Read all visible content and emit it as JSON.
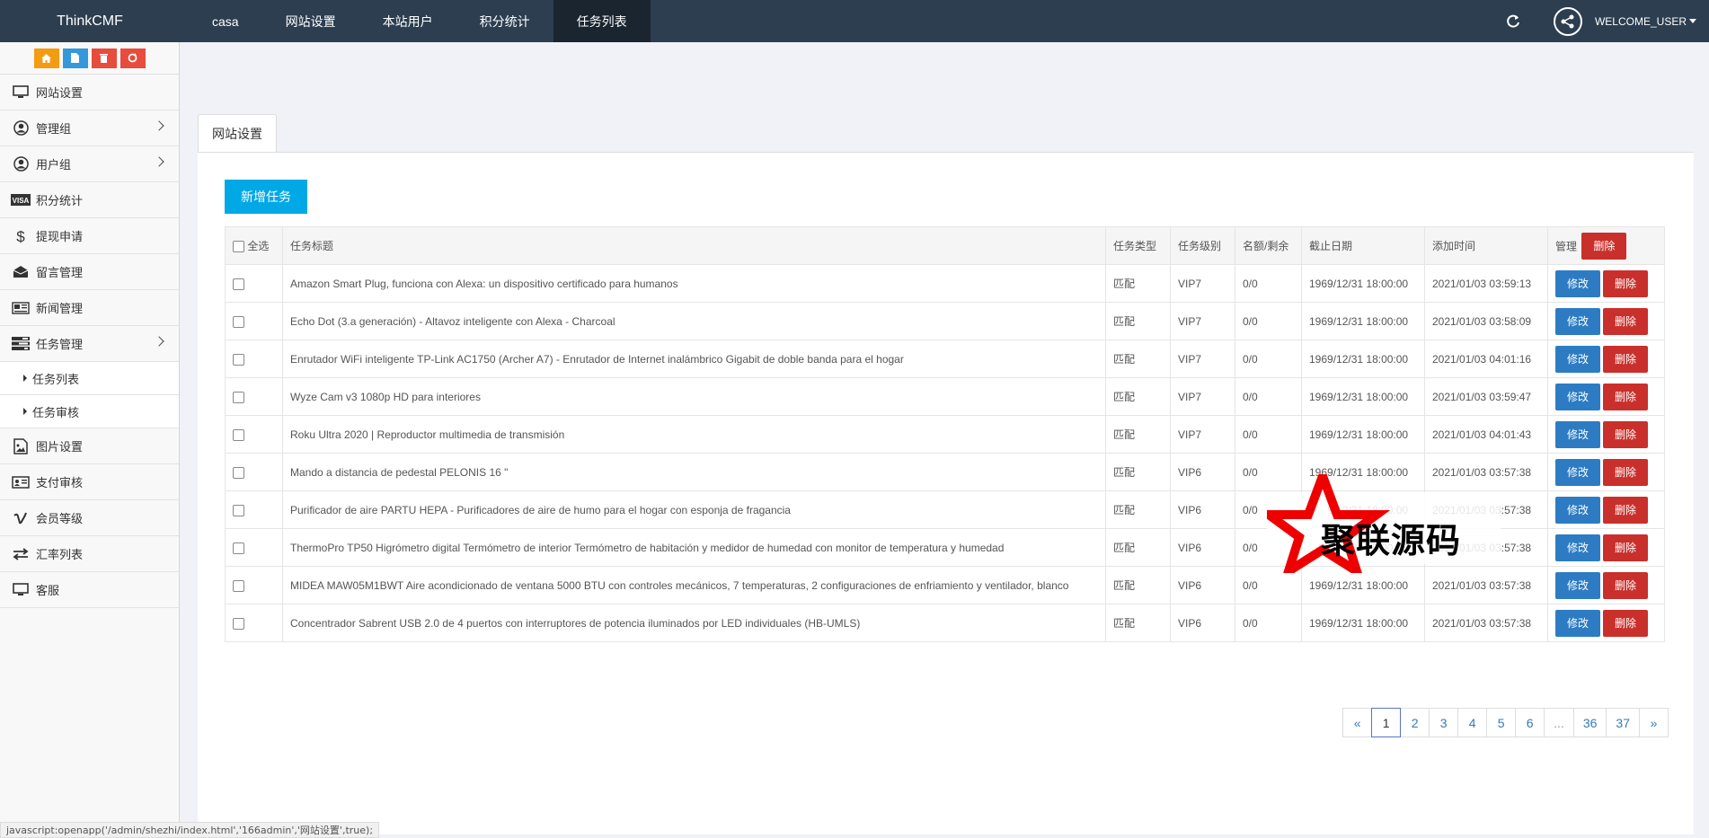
{
  "brand": "ThinkCMF",
  "topnav": [
    {
      "label": "casa",
      "active": false
    },
    {
      "label": "网站设置",
      "active": false
    },
    {
      "label": "本站用户",
      "active": false
    },
    {
      "label": "积分统计",
      "active": false
    },
    {
      "label": "任务列表",
      "active": true
    }
  ],
  "user": {
    "name": "WELCOME_USER"
  },
  "sidebar": {
    "items": [
      {
        "label": "网站设置",
        "icon": "monitor-icon"
      },
      {
        "label": "管理组",
        "icon": "user-circle-icon",
        "arrow": true
      },
      {
        "label": "用户组",
        "icon": "user-circle-icon",
        "arrow": true
      },
      {
        "label": "积分统计",
        "icon": "visa-card-icon"
      },
      {
        "label": "提现申请",
        "icon": "dollar-icon"
      },
      {
        "label": "留言管理",
        "icon": "envelope-icon"
      },
      {
        "label": "新闻管理",
        "icon": "newspaper-icon"
      },
      {
        "label": "任务管理",
        "icon": "tasks-icon",
        "arrow": true
      },
      {
        "label": "任务列表",
        "icon": "",
        "sub": true
      },
      {
        "label": "任务审核",
        "icon": "",
        "sub": true
      },
      {
        "label": "图片设置",
        "icon": "image-icon"
      },
      {
        "label": "支付审核",
        "icon": "id-card-icon"
      },
      {
        "label": "会员等级",
        "icon": "vimeo-icon"
      },
      {
        "label": "汇率列表",
        "icon": "exchange-icon"
      },
      {
        "label": "客服",
        "icon": "monitor-icon"
      }
    ]
  },
  "tab_label": "网站设置",
  "add_button": "新增任务",
  "table": {
    "headers": {
      "select_all": "全选",
      "title": "任务标题",
      "type": "任务类型",
      "level": "任务级别",
      "quota": "名额/剩余",
      "deadline": "截止日期",
      "added": "添加时间",
      "manage": "管理",
      "delete": "删除"
    },
    "edit_label": "修改",
    "delete_label": "删除",
    "rows": [
      {
        "title": "Amazon Smart Plug, funciona con Alexa: un dispositivo certificado para humanos",
        "type": "匹配",
        "level": "VIP7",
        "quota": "0/0",
        "deadline": "1969/12/31 18:00:00",
        "added": "2021/01/03 03:59:13"
      },
      {
        "title": "Echo Dot (3.a generación) - Altavoz inteligente con Alexa - Charcoal",
        "type": "匹配",
        "level": "VIP7",
        "quota": "0/0",
        "deadline": "1969/12/31 18:00:00",
        "added": "2021/01/03 03:58:09"
      },
      {
        "title": "Enrutador WiFi inteligente TP-Link AC1750 (Archer A7) - Enrutador de Internet inalámbrico Gigabit de doble banda para el hogar",
        "type": "匹配",
        "level": "VIP7",
        "quota": "0/0",
        "deadline": "1969/12/31 18:00:00",
        "added": "2021/01/03 04:01:16"
      },
      {
        "title": "Wyze Cam v3 1080p HD para interiores",
        "type": "匹配",
        "level": "VIP7",
        "quota": "0/0",
        "deadline": "1969/12/31 18:00:00",
        "added": "2021/01/03 03:59:47"
      },
      {
        "title": "Roku Ultra 2020 | Reproductor multimedia de transmisión",
        "type": "匹配",
        "level": "VIP7",
        "quota": "0/0",
        "deadline": "1969/12/31 18:00:00",
        "added": "2021/01/03 04:01:43"
      },
      {
        "title": "Mando a distancia de pedestal PELONIS 16 \"",
        "type": "匹配",
        "level": "VIP6",
        "quota": "0/0",
        "deadline": "1969/12/31 18:00:00",
        "added": "2021/01/03 03:57:38"
      },
      {
        "title": "Purificador de aire PARTU HEPA - Purificadores de aire de humo para el hogar con esponja de fragancia",
        "type": "匹配",
        "level": "VIP6",
        "quota": "0/0",
        "deadline": "1969/12/31 18:00:00",
        "added": "2021/01/03 03:57:38"
      },
      {
        "title": "ThermoPro TP50 Higrómetro digital Termómetro de interior Termómetro de habitación y medidor de humedad con monitor de temperatura y humedad",
        "type": "匹配",
        "level": "VIP6",
        "quota": "0/0",
        "deadline": "1969/12/31 18:00:00",
        "added": "2021/01/03 03:57:38"
      },
      {
        "title": "MIDEA MAW05M1BWT Aire acondicionado de ventana 5000 BTU con controles mecánicos, 7 temperaturas, 2 configuraciones de enfriamiento y ventilador, blanco",
        "type": "匹配",
        "level": "VIP6",
        "quota": "0/0",
        "deadline": "1969/12/31 18:00:00",
        "added": "2021/01/03 03:57:38"
      },
      {
        "title": "Concentrador Sabrent USB 2.0 de 4 puertos con interruptores de potencia iluminados por LED individuales (HB-UMLS)",
        "type": "匹配",
        "level": "VIP6",
        "quota": "0/0",
        "deadline": "1969/12/31 18:00:00",
        "added": "2021/01/03 03:57:38"
      }
    ]
  },
  "pagination": [
    "«",
    "1",
    "2",
    "3",
    "4",
    "5",
    "6",
    "...",
    "36",
    "37",
    "»"
  ],
  "pagination_active": "1",
  "watermark_text": "聚联源码",
  "status_text": "javascript:openapp('/admin/shezhi/index.html','166admin','网站设置',true);"
}
